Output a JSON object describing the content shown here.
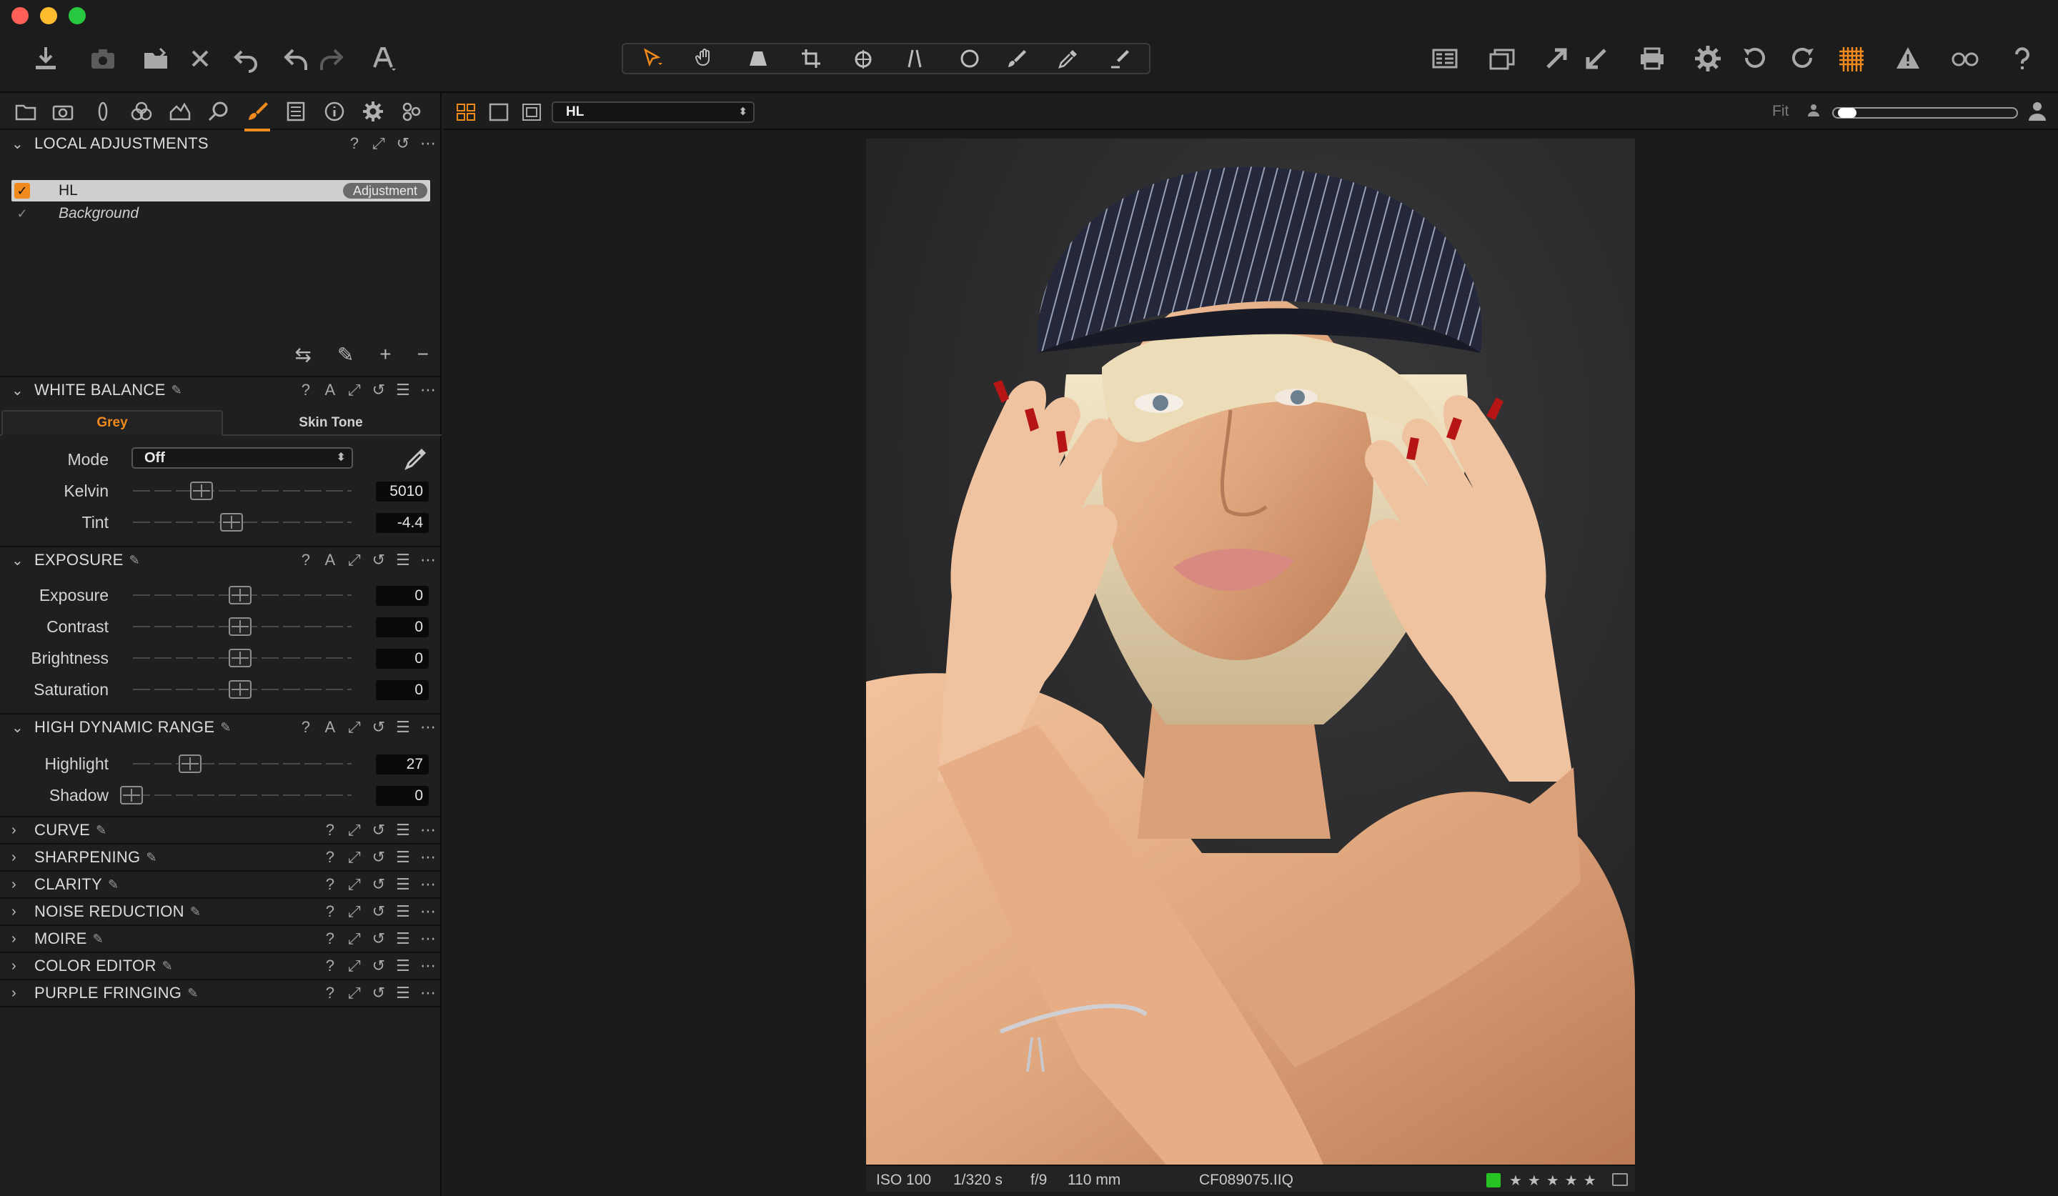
{
  "toolbar": {
    "left_icons": [
      "import-icon",
      "camera-icon",
      "open-folder-icon",
      "delete-icon",
      "undo-history-icon",
      "undo-icon",
      "redo-icon",
      "text-style-icon"
    ],
    "cursor_tools": [
      "select-pointer-icon",
      "pan-hand-icon",
      "keystone-icon",
      "crop-icon",
      "rotate-icon",
      "straighten-icon",
      "circle-mask-icon",
      "brush-icon",
      "picker-icon",
      "eraser-icon"
    ],
    "right_icons": [
      "layout-icon",
      "stack-icon",
      "export-icon",
      "import-arrow-icon",
      "print-icon",
      "settings-gear-icon",
      "rotate-left-icon",
      "rotate-right-icon",
      "grid-overlay-icon",
      "exposure-warning-icon",
      "proof-glasses-icon",
      "help-icon"
    ],
    "active_color": "#f08a1c"
  },
  "tool_tabs": {
    "icons": [
      "library-icon",
      "capture-icon",
      "lens-icon",
      "color-icon",
      "exposure-tab-icon",
      "detail-icon",
      "local-adjust-brush-icon",
      "output-icon",
      "metadata-icon",
      "gear-tab-icon",
      "batch-icon"
    ],
    "active": "local-adjust-brush-icon"
  },
  "local_adjustments": {
    "title": "LOCAL ADJUSTMENTS",
    "layers": [
      {
        "name": "HL",
        "badge": "Adjustment",
        "checked": true,
        "selected": true
      },
      {
        "name": "Background",
        "checked": true,
        "selected": false
      }
    ]
  },
  "white_balance": {
    "title": "WHITE BALANCE",
    "tabs": [
      "Grey",
      "Skin Tone"
    ],
    "active_tab": "Grey",
    "mode_label": "Mode",
    "mode_value": "Off",
    "kelvin_label": "Kelvin",
    "kelvin_value": "5010",
    "tint_label": "Tint",
    "tint_value": "-4.4"
  },
  "exposure": {
    "title": "EXPOSURE",
    "rows": [
      {
        "label": "Exposure",
        "value": "0"
      },
      {
        "label": "Contrast",
        "value": "0"
      },
      {
        "label": "Brightness",
        "value": "0"
      },
      {
        "label": "Saturation",
        "value": "0"
      }
    ]
  },
  "hdr": {
    "title": "HIGH DYNAMIC RANGE",
    "rows": [
      {
        "label": "Highlight",
        "value": "27"
      },
      {
        "label": "Shadow",
        "value": "0"
      }
    ]
  },
  "collapsed_sections": [
    "CURVE",
    "SHARPENING",
    "CLARITY",
    "NOISE REDUCTION",
    "MOIRE",
    "COLOR EDITOR",
    "PURPLE FRINGING"
  ],
  "viewer": {
    "variant": "HL",
    "fit_label": "Fit",
    "photo_info": {
      "iso": "ISO 100",
      "shutter": "1/320 s",
      "aperture": "f/9",
      "focal": "110 mm",
      "filename": "CF089075.IIQ",
      "stars": "★★★★★",
      "color_tag": "#27c224"
    }
  }
}
